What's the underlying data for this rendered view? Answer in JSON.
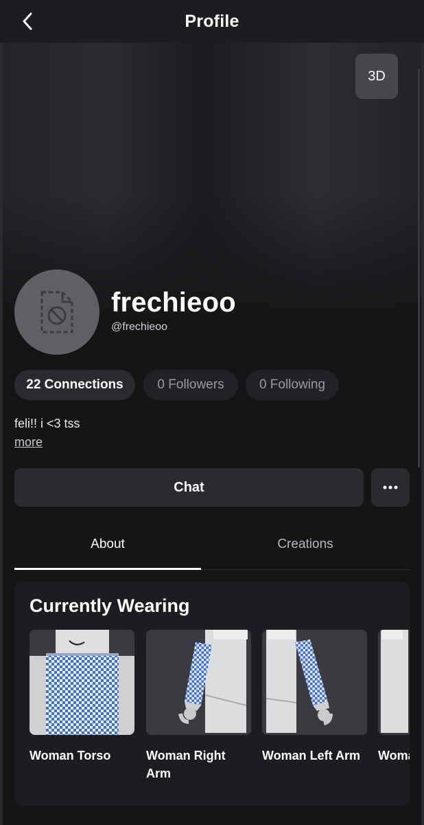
{
  "header": {
    "title": "Profile"
  },
  "banner": {
    "view_3d_label": "3D"
  },
  "profile": {
    "display_name": "frechieoo",
    "username": "@frechieoo",
    "bio": "feli!! i <3 tss",
    "more_label": "more"
  },
  "stats": {
    "connections": "22 Connections",
    "followers": "0 Followers",
    "following": "0 Following"
  },
  "actions": {
    "chat_label": "Chat"
  },
  "tabs": [
    {
      "label": "About",
      "active": true
    },
    {
      "label": "Creations",
      "active": false
    }
  ],
  "currently_wearing": {
    "title": "Currently Wearing",
    "items": [
      {
        "name": "Woman Torso"
      },
      {
        "name": "Woman Right Arm"
      },
      {
        "name": "Woman Left Arm"
      },
      {
        "name": "Woman Left Leg"
      }
    ]
  },
  "colors": {
    "background": "#141517",
    "surface": "#2a2b2f",
    "checker_blue": "#3d6fd6"
  }
}
